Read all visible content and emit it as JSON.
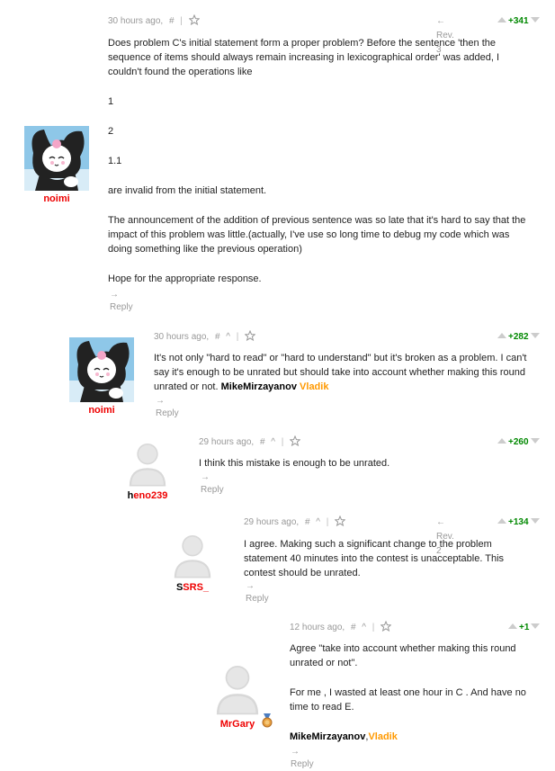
{
  "comments": [
    {
      "time": "30 hours ago,",
      "hash": "#",
      "caret": "",
      "revision": "← Rev. 3",
      "votes": "+341",
      "handle": {
        "first": "noimi",
        "rest": ""
      },
      "avatar": "kuromi-avatar",
      "paragraphs": [
        "Does problem C's initial statement form a proper problem? Before the sentence 'then the sequence of items should always remain increasing in lexicographical order' was added, I couldn't found the operations like",
        "1",
        "2",
        "1.1",
        "are invalid from the initial statement.",
        "The announcement of the addition of previous sentence was so late that it's hard to say that the impact of this problem was little.(actually, I've use so long time to debug my code which was doing something like the previous operation)",
        "Hope for the appropriate response."
      ],
      "reply": "→ Reply"
    },
    {
      "time": "30 hours ago,",
      "hash": "#",
      "caret": "^",
      "revision": "",
      "votes": "+282",
      "handle": {
        "first": "noimi",
        "rest": ""
      },
      "avatar": "kuromi-avatar",
      "text": "It's not only \"hard to read\" or \"hard to understand\" but it's broken as a problem. I can't say it's enough to be unrated but should take into account whether making this round unrated or not. ",
      "mention1": "MikeMirzayanov",
      "mention2": "Vladik",
      "reply": "→ Reply"
    },
    {
      "time": "29 hours ago,",
      "hash": "#",
      "caret": "^",
      "revision": "",
      "votes": "+260",
      "handle": {
        "first": "h",
        "rest": "eno239"
      },
      "avatar": "default-user-avatar",
      "text": "I think this mistake is enough to be unrated.",
      "reply": "→ Reply"
    },
    {
      "time": "29 hours ago,",
      "hash": "#",
      "caret": "^",
      "revision": "← Rev. 2",
      "votes": "+134",
      "handle": {
        "first": "S",
        "rest": "SRS_"
      },
      "avatar": "default-user-avatar",
      "text": "I agree. Making such a significant change to the problem statement 40 minutes into the contest is unacceptable. This contest should be unrated.",
      "reply": "→ Reply"
    },
    {
      "time": "12 hours ago,",
      "hash": "#",
      "caret": "^",
      "revision": "",
      "votes": "+1",
      "handle": {
        "first": "MrGary",
        "rest": ""
      },
      "avatar": "default-user-avatar",
      "paragraphs": [
        "Agree \"take into account whether making this round unrated or not\".",
        "For me , I wasted at least one hour in C . And have no time to read E."
      ],
      "mention1": "MikeMirzayanov",
      "comma": ",",
      "mention2": "Vladik",
      "reply": "→ Reply"
    }
  ],
  "colors": {
    "red": "#ee0000",
    "orange": "#ff9900",
    "green": "#008800",
    "gray": "#999999"
  }
}
